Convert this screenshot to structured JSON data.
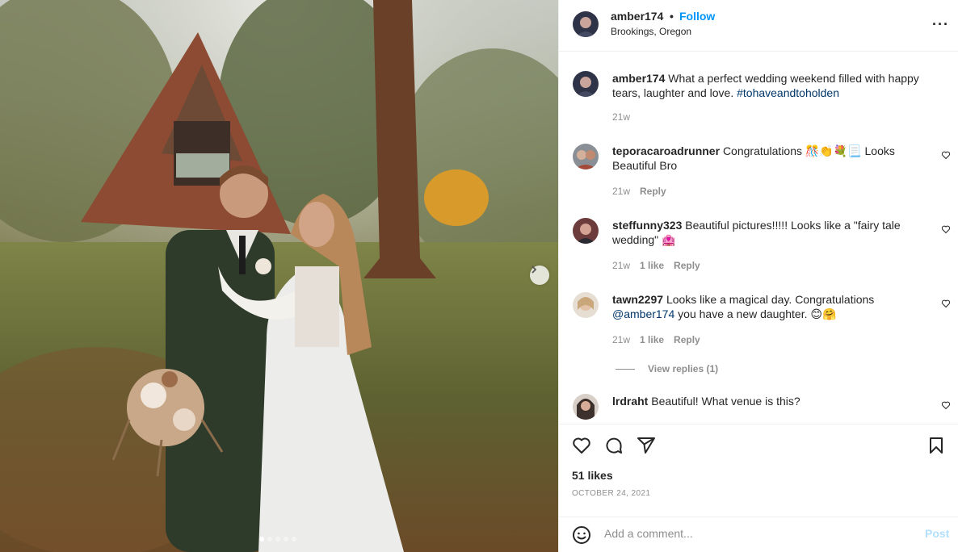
{
  "header": {
    "username": "amber174",
    "separator": "•",
    "follow_label": "Follow",
    "location": "Brookings, Oregon",
    "more_icon": "more-horizontal-icon"
  },
  "caption": {
    "username": "amber174",
    "text": "What a perfect wedding weekend filled with happy tears, laughter and love.",
    "hashtag": "#tohaveandtoholden",
    "time": "21w"
  },
  "comments": [
    {
      "username": "teporacaroadrunner",
      "text": "Congratulations 🎊👏💐📃 Looks Beautiful Bro",
      "time": "21w",
      "likes": "",
      "reply": "Reply"
    },
    {
      "username": "steffunny323",
      "text": "Beautiful pictures!!!!! Looks like a \"fairy tale wedding\" 🏩",
      "time": "21w",
      "likes": "1 like",
      "reply": "Reply"
    },
    {
      "username": "tawn2297",
      "text_before": "Looks like a magical day. Congratulations",
      "mention": "@amber174",
      "text_after": "you have a new daughter. 😊🤗",
      "time": "21w",
      "likes": "1 like",
      "reply": "Reply"
    },
    {
      "username": "lrdraht",
      "text": "Beautiful! What venue is this?"
    }
  ],
  "view_replies": "View replies (1)",
  "likes": "51 likes",
  "date": "OCTOBER 24, 2021",
  "add_comment": {
    "placeholder": "Add a comment...",
    "post_label": "Post"
  },
  "carousel": {
    "count": 5,
    "active": 0
  },
  "colors": {
    "link": "#00376b",
    "follow": "#0095f6",
    "post_disabled": "#b2dffc",
    "meta": "#8e8e8e"
  }
}
